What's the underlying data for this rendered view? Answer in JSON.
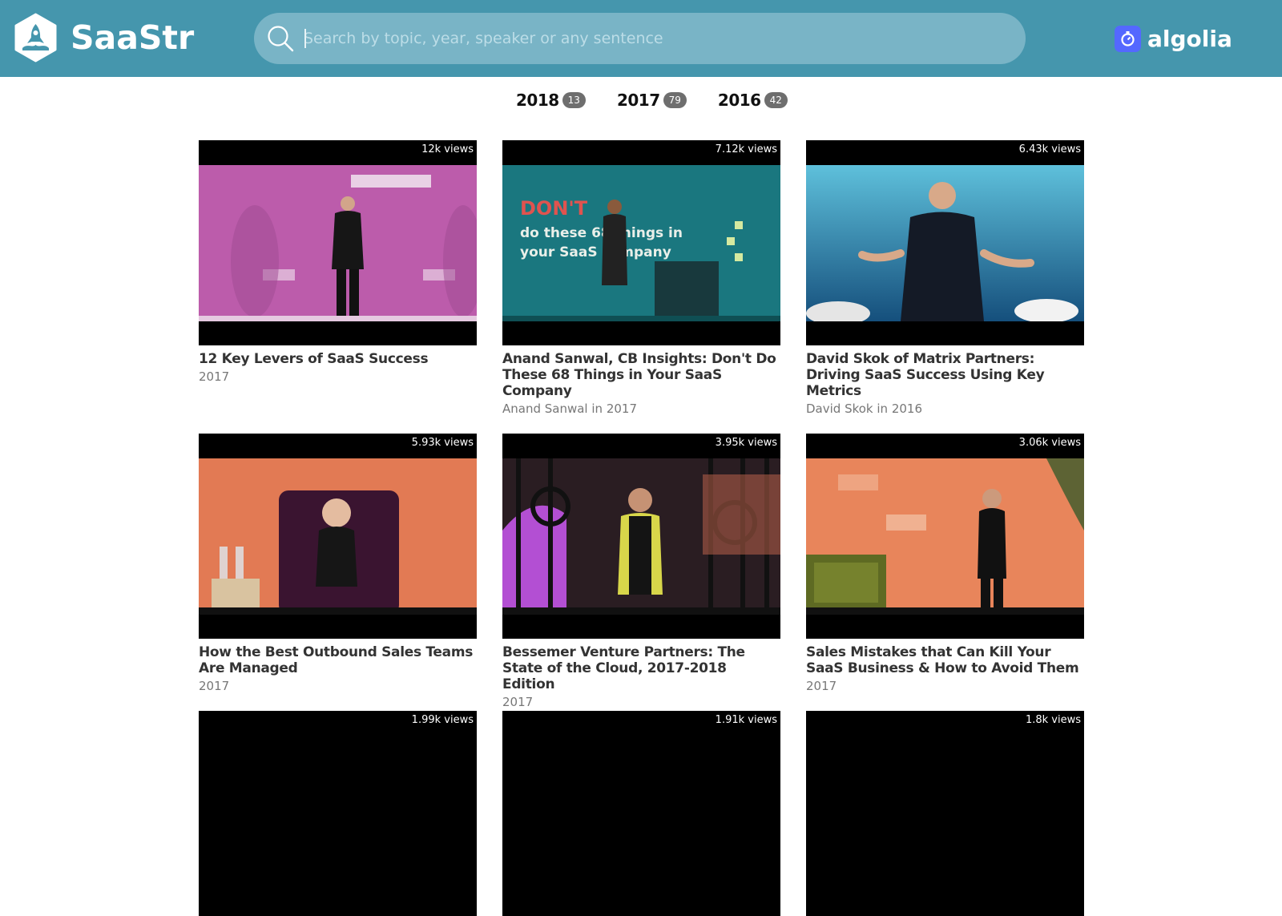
{
  "header": {
    "logo_text": "SaaStr",
    "search_placeholder": "Search by topic, year, speaker or any sentence",
    "search_value": "",
    "powered_by": "algolia",
    "colors": {
      "bar": "#4596ad",
      "search_bg": "#79b4c6",
      "algolia": "#5468ff"
    }
  },
  "facets": [
    {
      "year": "2018",
      "count": "13"
    },
    {
      "year": "2017",
      "count": "79"
    },
    {
      "year": "2016",
      "count": "42"
    }
  ],
  "videos": [
    {
      "views": "12k views",
      "title": "12 Key Levers of SaaS Success",
      "meta": "2017",
      "scene": "pink"
    },
    {
      "views": "7.12k views",
      "title": "Anand Sanwal, CB Insights: Don't Do These 68 Things in Your SaaS Company",
      "meta": "Anand Sanwal in 2017",
      "scene": "teal",
      "slide_heading": "DON'T",
      "slide_text": "do these 68 things in your SaaS company"
    },
    {
      "views": "6.43k views",
      "title": "David Skok of Matrix Partners: Driving SaaS Success Using Key Metrics",
      "meta": "David Skok in 2016",
      "scene": "blue"
    },
    {
      "views": "5.93k views",
      "title": "How the Best Outbound Sales Teams Are Managed",
      "meta": "2017",
      "scene": "orange-chair"
    },
    {
      "views": "3.95k views",
      "title": "Bessemer Venture Partners: The State of the Cloud, 2017-2018 Edition",
      "meta": "2017",
      "scene": "gate"
    },
    {
      "views": "3.06k views",
      "title": "Sales Mistakes that Can Kill Your SaaS Business & How to Avoid Them",
      "meta": "2017",
      "scene": "orange-green"
    },
    {
      "views": "1.99k views",
      "title": "",
      "meta": "",
      "scene": "cut"
    },
    {
      "views": "1.91k views",
      "title": "",
      "meta": "",
      "scene": "cut"
    },
    {
      "views": "1.8k views",
      "title": "",
      "meta": "",
      "scene": "cut"
    }
  ]
}
